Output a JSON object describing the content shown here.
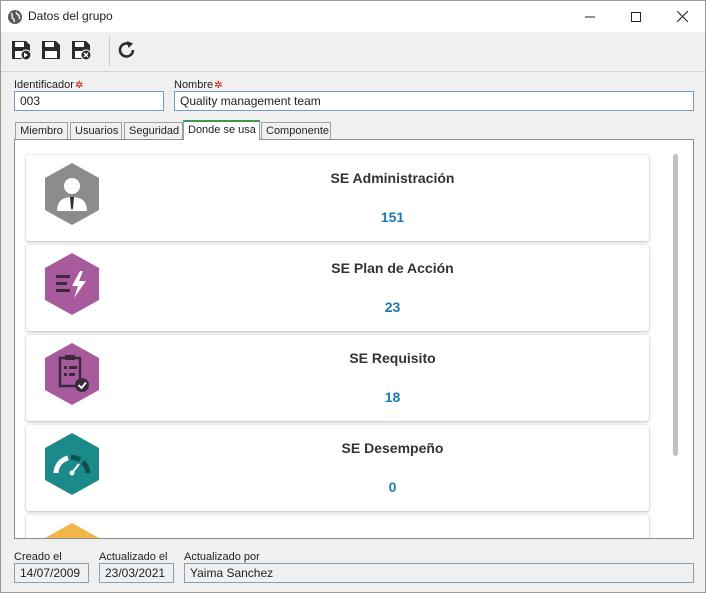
{
  "window": {
    "title": "Datos del grupo"
  },
  "toolbar": {
    "buttons": [
      {
        "icon": "save-new-icon"
      },
      {
        "icon": "save-icon"
      },
      {
        "icon": "save-close-icon"
      },
      {
        "icon": "refresh-icon"
      }
    ]
  },
  "form": {
    "identificador": {
      "label": "Identificador",
      "value": "003"
    },
    "nombre": {
      "label": "Nombre",
      "value": "Quality management team"
    }
  },
  "tabs": [
    {
      "label": "Miembro",
      "active": false
    },
    {
      "label": "Usuarios",
      "active": false
    },
    {
      "label": "Seguridad",
      "active": false
    },
    {
      "label": "Donde se usa",
      "active": true
    },
    {
      "label": "Componente",
      "active": false
    }
  ],
  "modules": [
    {
      "name": "SE Administración",
      "count": "151",
      "icon": "user-icon",
      "color": "#8c8c8c"
    },
    {
      "name": "SE Plan de Acción",
      "count": "23",
      "icon": "action-plan-icon",
      "color": "#a75b9d"
    },
    {
      "name": "SE Requisito",
      "count": "18",
      "icon": "requirement-icon",
      "color": "#a75b9d"
    },
    {
      "name": "SE Desempeño",
      "count": "0",
      "icon": "gauge-icon",
      "color": "#1b8a8a"
    }
  ],
  "footer": {
    "creado": {
      "label": "Creado el",
      "value": "14/07/2009"
    },
    "actualizado": {
      "label": "Actualizado el",
      "value": "23/03/2021"
    },
    "actualizado_por": {
      "label": "Actualizado por",
      "value": "Yaima Sanchez"
    }
  },
  "colors": {
    "accent": "#1a7ab8",
    "required": "#d00000",
    "active_tab": "#3a9a4a"
  }
}
